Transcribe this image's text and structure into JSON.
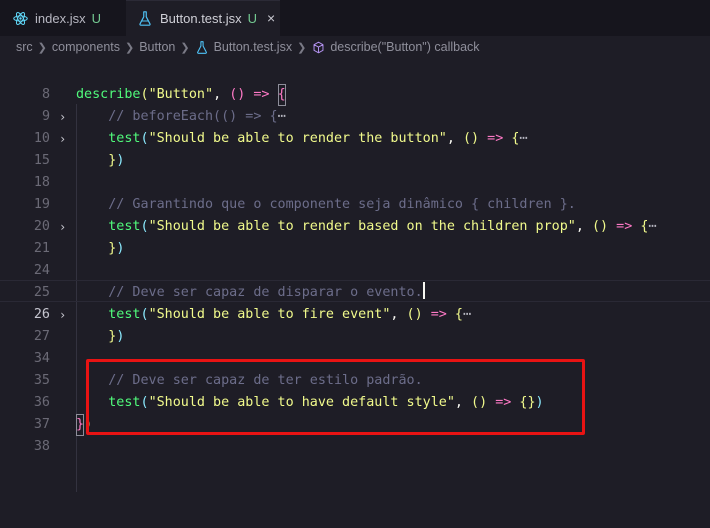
{
  "tabs": [
    {
      "label": "index.jsx",
      "status": "U",
      "icon": "react-icon",
      "active": false
    },
    {
      "label": "Button.test.jsx",
      "status": "U",
      "icon": "flask-icon",
      "active": true,
      "close": "×"
    }
  ],
  "breadcrumb": [
    "src",
    "components",
    "Button",
    "Button.test.jsx",
    "describe(\"Button\") callback"
  ],
  "colors": {
    "accent": "#50fa7b",
    "highlight_box": "#e81313",
    "modified": "#73c991"
  },
  "fold_glyph": "›",
  "lines": [
    {
      "n": "8"
    },
    {
      "n": "9"
    },
    {
      "n": "10",
      "folded": true
    },
    {
      "n": "15",
      "folded": true
    },
    {
      "n": "18"
    },
    {
      "n": "19"
    },
    {
      "n": "20"
    },
    {
      "n": "21",
      "folded": true
    },
    {
      "n": "24"
    },
    {
      "n": "25"
    },
    {
      "n": "26",
      "current": true
    },
    {
      "n": "27",
      "folded": true
    },
    {
      "n": "34"
    },
    {
      "n": "35"
    },
    {
      "n": "36"
    },
    {
      "n": "37"
    },
    {
      "n": "38"
    }
  ],
  "code": {
    "l9": {
      "kw": "describe",
      "str": "\"Button\"",
      "arrow": "=>"
    },
    "l10": {
      "comment": "// beforeEach(() => {"
    },
    "l15": {
      "kw": "test",
      "str": "\"Should be able to render the button\"",
      "arrow": "=>"
    },
    "l20": {
      "comment": "// Garantindo que o componente seja dinâmico { children }."
    },
    "l21": {
      "kw": "test",
      "str": "\"Should be able to render based on the children prop\"",
      "arrow": "=>"
    },
    "l26": {
      "comment": "// Deve ser capaz de disparar o evento."
    },
    "l27": {
      "kw": "test",
      "str": "\"Should be able to fire event\"",
      "arrow": "=>"
    },
    "l36": {
      "comment": "// Deve ser capaz de ter estilo padrão."
    },
    "l37": {
      "kw": "test",
      "str": "\"Should be able to have default style\"",
      "arrow": "=>"
    },
    "ellipsis": "⋯"
  }
}
